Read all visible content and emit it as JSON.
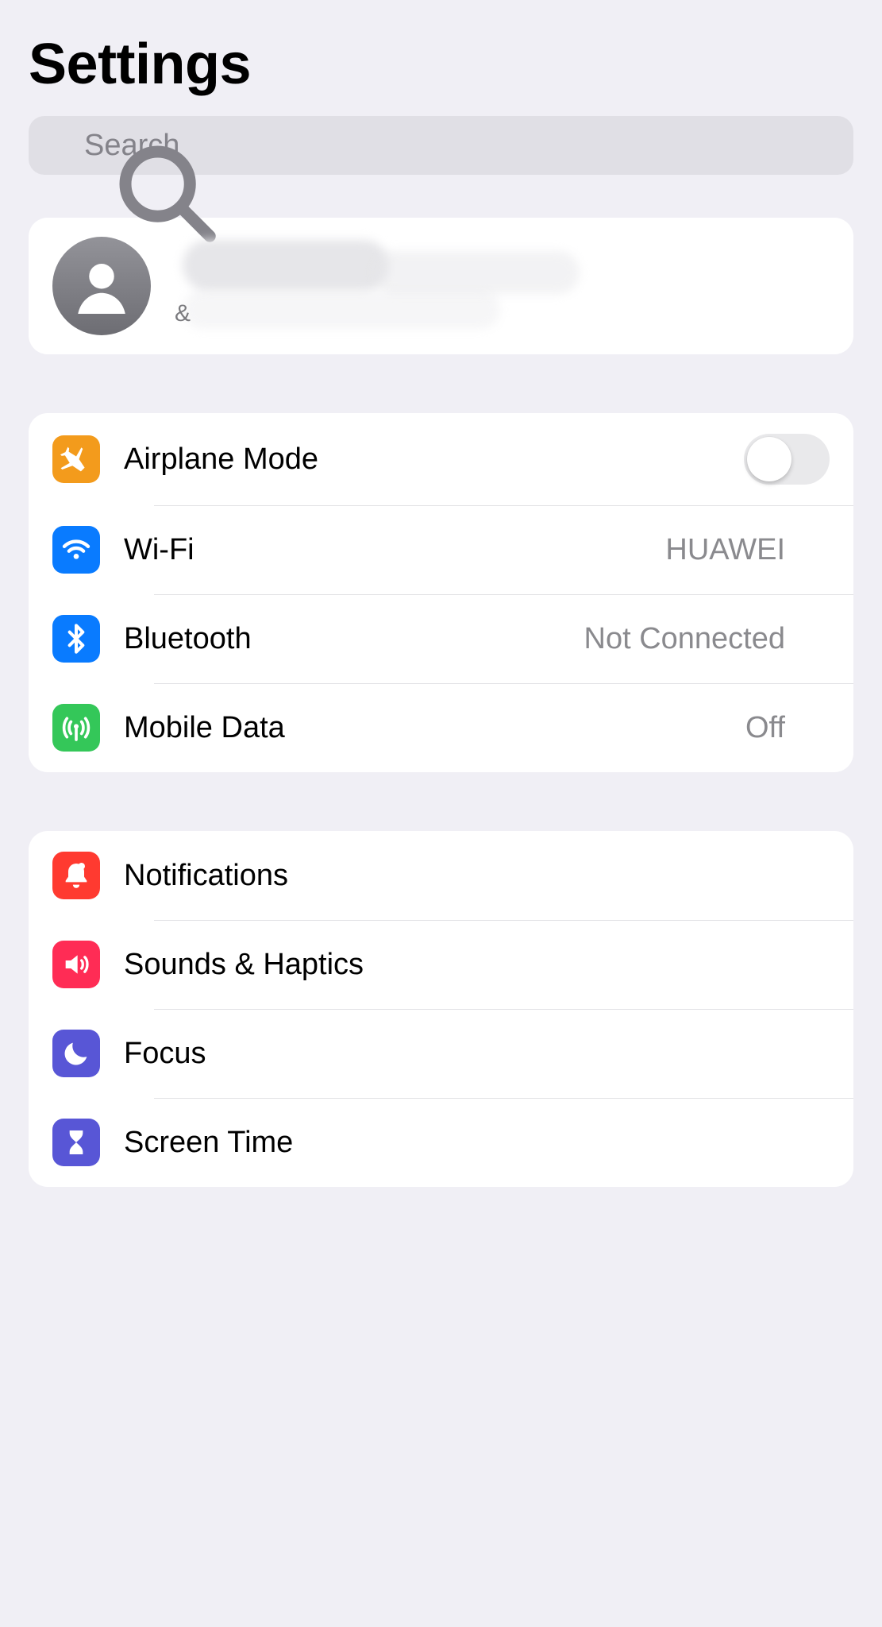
{
  "header": {
    "title": "Settings"
  },
  "search": {
    "placeholder": "Search",
    "value": ""
  },
  "account": {
    "subtitle_visible": "&"
  },
  "group_connectivity": [
    {
      "key": "airplane",
      "label": "Airplane Mode",
      "value": "",
      "toggle": false,
      "icon": "airplane",
      "bg": "bg-orange"
    },
    {
      "key": "wifi",
      "label": "Wi-Fi",
      "value": "HUAWEI",
      "chevron": true,
      "icon": "wifi",
      "bg": "bg-blue"
    },
    {
      "key": "bluetooth",
      "label": "Bluetooth",
      "value": "Not Connected",
      "chevron": true,
      "icon": "bluetooth",
      "bg": "bg-blue"
    },
    {
      "key": "mobiledata",
      "label": "Mobile Data",
      "value": "Off",
      "chevron": true,
      "icon": "antenna",
      "bg": "bg-green"
    }
  ],
  "group_alerts": [
    {
      "key": "notifications",
      "label": "Notifications",
      "value": "",
      "chevron": true,
      "icon": "bell",
      "bg": "bg-red"
    },
    {
      "key": "sounds",
      "label": "Sounds & Haptics",
      "value": "",
      "chevron": true,
      "icon": "speaker",
      "bg": "bg-pink"
    },
    {
      "key": "focus",
      "label": "Focus",
      "value": "",
      "chevron": true,
      "icon": "moon",
      "bg": "bg-indigo"
    },
    {
      "key": "screentime",
      "label": "Screen Time",
      "value": "",
      "chevron": true,
      "icon": "hourglass",
      "bg": "bg-indigo"
    }
  ]
}
